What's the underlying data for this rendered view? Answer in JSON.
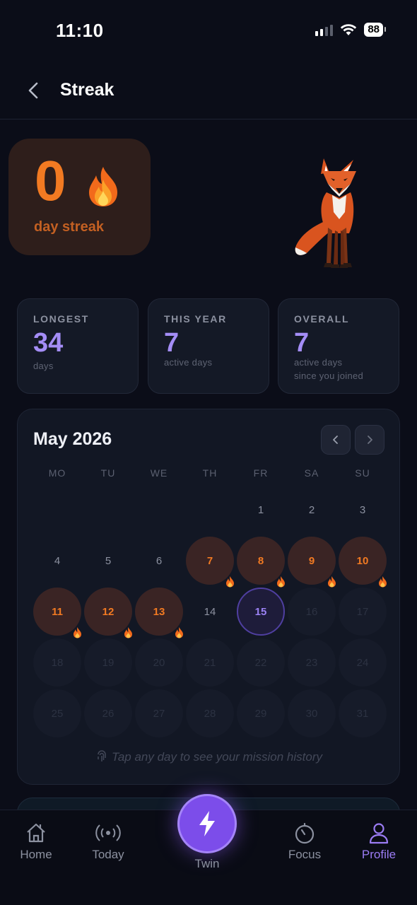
{
  "status_bar": {
    "time": "11:10",
    "battery": "88"
  },
  "header": {
    "title": "Streak"
  },
  "streak": {
    "count": "0",
    "label": "day streak"
  },
  "stats": [
    {
      "title": "LONGEST",
      "value": "34",
      "sub": "days",
      "sub2": ""
    },
    {
      "title": "THIS YEAR",
      "value": "7",
      "sub": "active days",
      "sub2": ""
    },
    {
      "title": "OVERALL",
      "value": "7",
      "sub": "active days",
      "sub2": "since you joined"
    }
  ],
  "calendar": {
    "month": "May 2026",
    "weekdays": [
      "MO",
      "TU",
      "WE",
      "TH",
      "FR",
      "SA",
      "SU"
    ],
    "days": [
      "1",
      "2",
      "3",
      "4",
      "5",
      "6",
      "7",
      "8",
      "9",
      "10",
      "11",
      "12",
      "13",
      "14",
      "15",
      "16",
      "17",
      "18",
      "19",
      "20",
      "21",
      "22",
      "23",
      "24",
      "25",
      "26",
      "27",
      "28",
      "29",
      "30",
      "31"
    ],
    "first_weekday_index": 4,
    "active_days": [
      7,
      8,
      9,
      10,
      11,
      12,
      13
    ],
    "today": 15,
    "hint": "Tap any day to see your mission history"
  },
  "tabs": [
    {
      "label": "Home",
      "icon": "home-icon"
    },
    {
      "label": "Today",
      "icon": "broadcast-icon"
    },
    {
      "label": "Twin",
      "icon": "lightning-icon"
    },
    {
      "label": "Focus",
      "icon": "timer-icon"
    },
    {
      "label": "Profile",
      "icon": "person-icon"
    }
  ],
  "colors": {
    "accent": "#9b7cf4",
    "streak_orange": "#f27a22",
    "background": "#0b0d18"
  }
}
